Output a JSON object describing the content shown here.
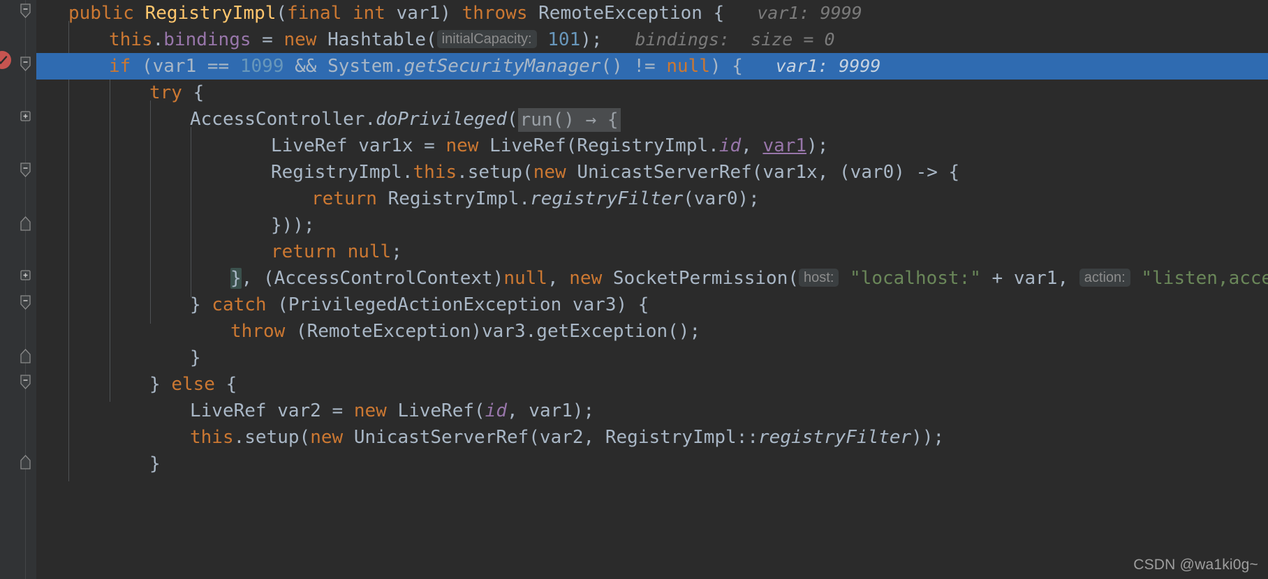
{
  "editor": {
    "theme_background": "#2b2b2b",
    "gutter_background": "#313335",
    "highlight_color": "#2f6bb1",
    "watermark": "CSDN @wa1ki0g~",
    "gutter": {
      "breakpoint_icon": "breakpoint-verified-icon",
      "fold_icons": [
        "fold-collapse-icon",
        "fold-collapse-icon",
        "fold-expand-icon",
        "fold-collapse-icon",
        "fold-end-icon",
        "fold-expand-icon",
        "fold-collapse-icon",
        "fold-end-icon",
        "fold-collapse-icon",
        "fold-end-icon"
      ]
    },
    "lines": [
      {
        "id": "line-signature",
        "indent": 0,
        "highlight": false,
        "tokens": [
          {
            "t": "public ",
            "c": "kw"
          },
          {
            "t": "RegistryImpl",
            "c": "fn"
          },
          {
            "t": "(",
            "c": "plain"
          },
          {
            "t": "final int ",
            "c": "kw"
          },
          {
            "t": "var1",
            "c": "plain"
          },
          {
            "t": ") ",
            "c": "plain"
          },
          {
            "t": "throws ",
            "c": "kw"
          },
          {
            "t": "RemoteException {",
            "c": "plain"
          }
        ],
        "debug_hint": "var1: 9999"
      },
      {
        "id": "line-bindings",
        "indent": 1,
        "highlight": false,
        "tokens": [
          {
            "t": "this",
            "c": "kw"
          },
          {
            "t": ".",
            "c": "plain"
          },
          {
            "t": "bindings",
            "c": "field"
          },
          {
            "t": " = ",
            "c": "plain"
          },
          {
            "t": "new ",
            "c": "kw"
          },
          {
            "t": "Hashtable(",
            "c": "plain"
          },
          {
            "t": "initialCapacity:",
            "c": "chip"
          },
          {
            "t": " ",
            "c": "plain"
          },
          {
            "t": "101",
            "c": "num"
          },
          {
            "t": ");",
            "c": "plain"
          }
        ],
        "debug_hint": "bindings:  size = 0"
      },
      {
        "id": "line-if-securitymanager",
        "indent": 1,
        "highlight": true,
        "tokens": [
          {
            "t": "if ",
            "c": "kw"
          },
          {
            "t": "(var1 == ",
            "c": "plain"
          },
          {
            "t": "1099",
            "c": "num"
          },
          {
            "t": " && System.",
            "c": "plain"
          },
          {
            "t": "getSecurityManager",
            "c": "fn-i"
          },
          {
            "t": "() != ",
            "c": "plain"
          },
          {
            "t": "null",
            "c": "kw"
          },
          {
            "t": ") {",
            "c": "plain"
          }
        ],
        "debug_hint": "var1: 9999"
      },
      {
        "id": "line-try",
        "indent": 2,
        "highlight": false,
        "tokens": [
          {
            "t": "try ",
            "c": "kw"
          },
          {
            "t": "{",
            "c": "plain"
          }
        ],
        "debug_hint": ""
      },
      {
        "id": "line-doprivileged",
        "indent": 3,
        "highlight": false,
        "tokens": [
          {
            "t": "AccessController.",
            "c": "plain"
          },
          {
            "t": "doPrivileged",
            "c": "fn-i"
          },
          {
            "t": "(",
            "c": "plain"
          },
          {
            "t": "run() → {",
            "c": "foldchip"
          }
        ],
        "debug_hint": ""
      },
      {
        "id": "line-liveref-var1x",
        "indent": 5,
        "highlight": false,
        "tokens": [
          {
            "t": "LiveRef var1x = ",
            "c": "plain"
          },
          {
            "t": "new ",
            "c": "kw"
          },
          {
            "t": "LiveRef(RegistryImpl.",
            "c": "plain"
          },
          {
            "t": "id",
            "c": "field-i"
          },
          {
            "t": ", ",
            "c": "plain"
          },
          {
            "t": "var1",
            "c": "underline"
          },
          {
            "t": ");",
            "c": "plain"
          }
        ],
        "debug_hint": ""
      },
      {
        "id": "line-setup-unicast",
        "indent": 5,
        "highlight": false,
        "tokens": [
          {
            "t": "RegistryImpl.",
            "c": "plain"
          },
          {
            "t": "this",
            "c": "kw"
          },
          {
            "t": ".setup(",
            "c": "plain"
          },
          {
            "t": "new ",
            "c": "kw"
          },
          {
            "t": "UnicastServerRef(var1x, (var0) -> {",
            "c": "plain"
          }
        ],
        "debug_hint": ""
      },
      {
        "id": "line-return-registryfilter",
        "indent": 6,
        "highlight": false,
        "tokens": [
          {
            "t": "return ",
            "c": "kw"
          },
          {
            "t": "RegistryImpl.",
            "c": "plain"
          },
          {
            "t": "registryFilter",
            "c": "fn-i"
          },
          {
            "t": "(var0);",
            "c": "plain"
          }
        ],
        "debug_hint": ""
      },
      {
        "id": "line-close-lambda",
        "indent": 5,
        "highlight": false,
        "tokens": [
          {
            "t": "}));",
            "c": "plain"
          }
        ],
        "debug_hint": ""
      },
      {
        "id": "line-return-null",
        "indent": 5,
        "highlight": false,
        "tokens": [
          {
            "t": "return ",
            "c": "kw"
          },
          {
            "t": "null",
            "c": "kw"
          },
          {
            "t": ";",
            "c": "plain"
          }
        ],
        "debug_hint": ""
      },
      {
        "id": "line-socketpermission",
        "indent": 4,
        "highlight": false,
        "tokens": [
          {
            "t": "}",
            "c": "bracematch"
          },
          {
            "t": ", (AccessControlContext)",
            "c": "plain"
          },
          {
            "t": "null",
            "c": "kw"
          },
          {
            "t": ", ",
            "c": "plain"
          },
          {
            "t": "new ",
            "c": "kw"
          },
          {
            "t": "SocketPermission(",
            "c": "plain"
          },
          {
            "t": "host:",
            "c": "chip"
          },
          {
            "t": " ",
            "c": "plain"
          },
          {
            "t": "\"localhost:\"",
            "c": "str"
          },
          {
            "t": " + var1",
            "c": "plain"
          },
          {
            "t": ", ",
            "c": "plain"
          },
          {
            "t": "action:",
            "c": "chip"
          },
          {
            "t": " ",
            "c": "plain"
          },
          {
            "t": "\"listen,acce",
            "c": "str"
          }
        ],
        "debug_hint": ""
      },
      {
        "id": "line-catch",
        "indent": 3,
        "highlight": false,
        "tokens": [
          {
            "t": "} ",
            "c": "plain"
          },
          {
            "t": "catch ",
            "c": "kw"
          },
          {
            "t": "(PrivilegedActionException var3) {",
            "c": "plain"
          }
        ],
        "debug_hint": ""
      },
      {
        "id": "line-throw",
        "indent": 4,
        "highlight": false,
        "tokens": [
          {
            "t": "throw ",
            "c": "kw"
          },
          {
            "t": "(RemoteException)var3.getException();",
            "c": "plain"
          }
        ],
        "debug_hint": ""
      },
      {
        "id": "line-close-catch",
        "indent": 3,
        "highlight": false,
        "tokens": [
          {
            "t": "}",
            "c": "plain"
          }
        ],
        "debug_hint": ""
      },
      {
        "id": "line-else",
        "indent": 2,
        "highlight": false,
        "tokens": [
          {
            "t": "} ",
            "c": "plain"
          },
          {
            "t": "else ",
            "c": "kw"
          },
          {
            "t": "{",
            "c": "plain"
          }
        ],
        "debug_hint": ""
      },
      {
        "id": "line-liveref-var2",
        "indent": 3,
        "highlight": false,
        "tokens": [
          {
            "t": "LiveRef var2 = ",
            "c": "plain"
          },
          {
            "t": "new ",
            "c": "kw"
          },
          {
            "t": "LiveRef(",
            "c": "plain"
          },
          {
            "t": "id",
            "c": "field-i"
          },
          {
            "t": ", var1);",
            "c": "plain"
          }
        ],
        "debug_hint": ""
      },
      {
        "id": "line-this-setup",
        "indent": 3,
        "highlight": false,
        "tokens": [
          {
            "t": "this",
            "c": "kw"
          },
          {
            "t": ".setup(",
            "c": "plain"
          },
          {
            "t": "new ",
            "c": "kw"
          },
          {
            "t": "UnicastServerRef(var2, RegistryImpl::",
            "c": "plain"
          },
          {
            "t": "registryFilter",
            "c": "fn-i"
          },
          {
            "t": "));",
            "c": "plain"
          }
        ],
        "debug_hint": ""
      },
      {
        "id": "line-close-else",
        "indent": 2,
        "highlight": false,
        "tokens": [
          {
            "t": "}",
            "c": "plain"
          }
        ],
        "debug_hint": ""
      }
    ]
  }
}
